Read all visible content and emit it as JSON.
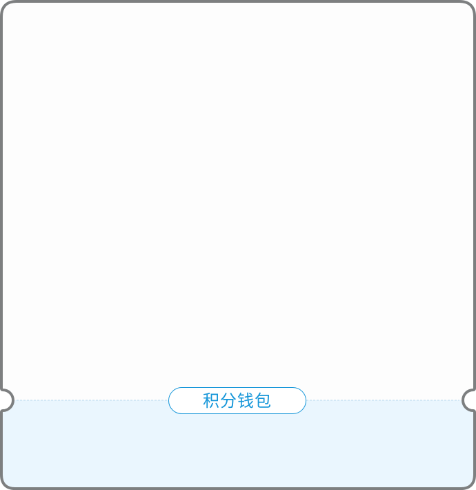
{
  "wallet": {
    "label": "积分钱包"
  },
  "colors": {
    "frame": "#7d7f80",
    "card_top": "#fdfdfd",
    "card_bottom": "#eaf6fe",
    "accent": "#1596d9",
    "divider": "#b8d8ee"
  }
}
